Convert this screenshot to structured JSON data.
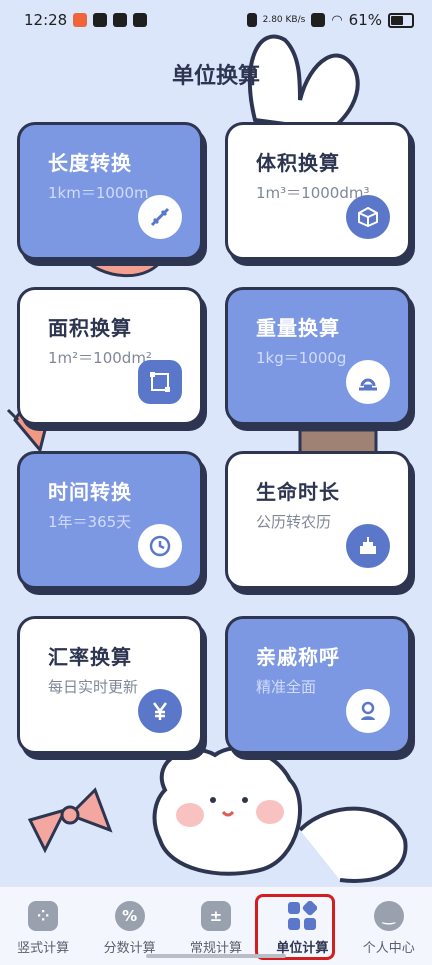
{
  "status_bar": {
    "time": "12:28",
    "net_speed": "2.80 KB/s",
    "battery": "61%"
  },
  "header": {
    "title": "单位换算"
  },
  "cards": [
    {
      "title": "长度转换",
      "subtitle": "1km＝1000m",
      "icon": "ruler-pencil-icon",
      "style": "blue"
    },
    {
      "title": "体积换算",
      "subtitle": "1m³＝1000dm³",
      "icon": "cube-icon",
      "style": "white"
    },
    {
      "title": "面积换算",
      "subtitle": "1m²＝100dm²",
      "icon": "area-square-icon",
      "style": "white"
    },
    {
      "title": "重量换算",
      "subtitle": "1kg＝1000g",
      "icon": "scale-icon",
      "style": "blue"
    },
    {
      "title": "时间转换",
      "subtitle": "1年＝365天",
      "icon": "clock-icon",
      "style": "blue"
    },
    {
      "title": "生命时长",
      "subtitle": "公历转农历",
      "icon": "cake-icon",
      "style": "white"
    },
    {
      "title": "汇率换算",
      "subtitle": "每日实时更新",
      "icon": "yen-icon",
      "style": "white"
    },
    {
      "title": "亲戚称呼",
      "subtitle": "精准全面",
      "icon": "person-icon",
      "style": "blue"
    }
  ],
  "bottom_nav": [
    {
      "label": "竖式计算",
      "icon": "grid-dots-icon"
    },
    {
      "label": "分数计算",
      "icon": "percent-icon"
    },
    {
      "label": "常规计算",
      "icon": "calculator-icon"
    },
    {
      "label": "单位计算",
      "icon": "tiles-icon",
      "active": true
    },
    {
      "label": "个人中心",
      "icon": "smile-icon"
    }
  ],
  "colors": {
    "background": "#dbe6fb",
    "card_blue": "#7d98e3",
    "outline": "#2e3550",
    "highlight": "#d41e1e"
  }
}
